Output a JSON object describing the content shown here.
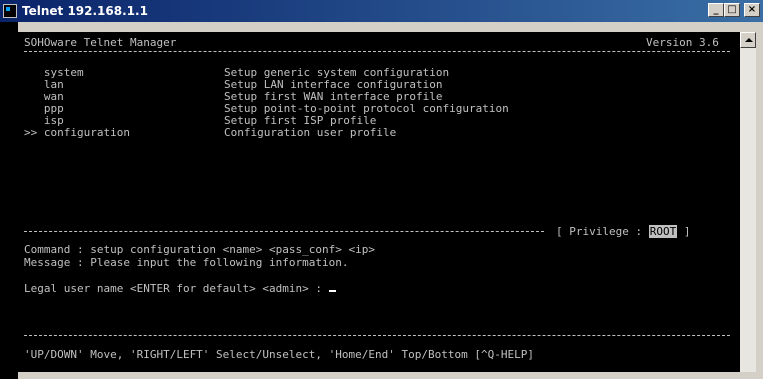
{
  "window": {
    "title": "Telnet 192.168.1.1",
    "min_label": "_",
    "max_label": "□",
    "close_label": "×"
  },
  "header": {
    "app_name": "SOHOware Telnet Manager",
    "version": "Version 3.6"
  },
  "menu": [
    {
      "prefix": "   ",
      "key": "system",
      "desc": "Setup generic system configuration"
    },
    {
      "prefix": "   ",
      "key": "lan",
      "desc": "Setup LAN interface configuration"
    },
    {
      "prefix": "   ",
      "key": "wan",
      "desc": "Setup first WAN interface profile"
    },
    {
      "prefix": "   ",
      "key": "ppp",
      "desc": "Setup point-to-point protocol configuration"
    },
    {
      "prefix": "   ",
      "key": "isp",
      "desc": "Setup first ISP profile"
    },
    {
      "prefix": ">> ",
      "key": "configuration",
      "desc": "Configuration user profile"
    }
  ],
  "privilege": {
    "label": "[ Privilege : ",
    "value": "ROOT",
    "close": " ]"
  },
  "command_line": "Command : setup configuration <name> <pass_conf> <ip>",
  "message_line": "Message : Please input the following information.",
  "prompt_line": "Legal user name <ENTER for default> <admin> : ",
  "footer_help": "'UP/DOWN' Move, 'RIGHT/LEFT' Select/Unselect, 'Home/End' Top/Bottom [^Q-HELP]"
}
